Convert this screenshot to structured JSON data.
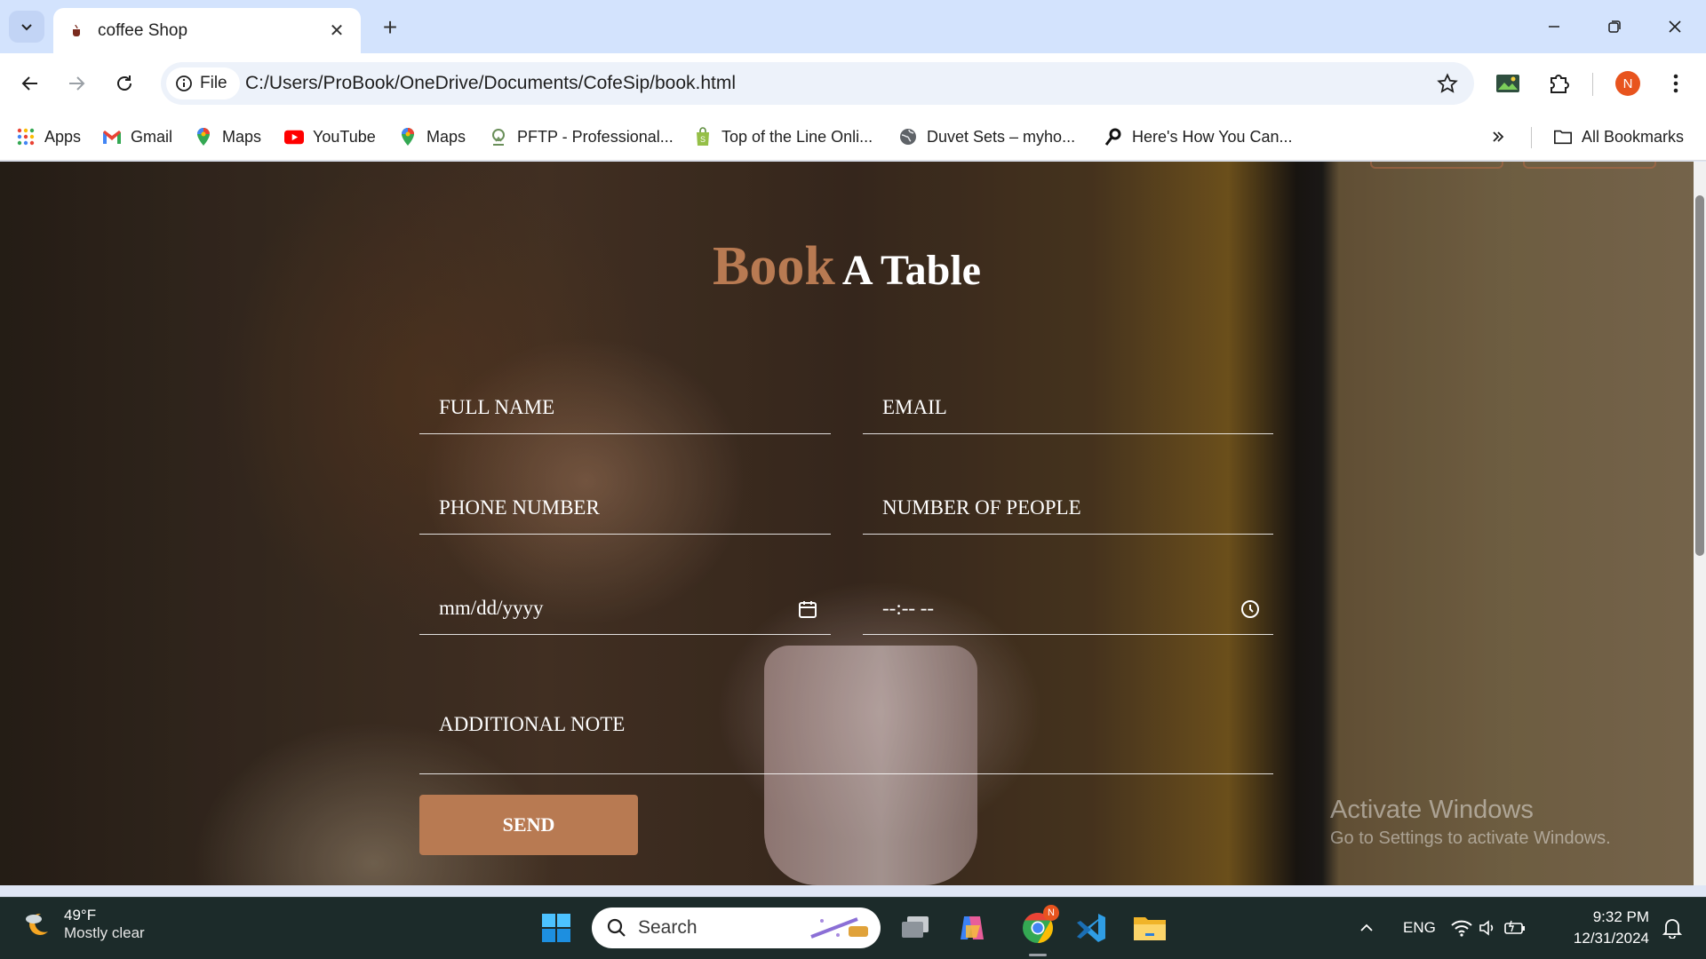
{
  "browser": {
    "tab_title": "coffee Shop",
    "site_chip": "File",
    "url": "C:/Users/ProBook/OneDrive/Documents/CofeSip/book.html",
    "profile_initial": "N",
    "bookmarks": [
      {
        "label": "Apps",
        "icon": "apps-grid-icon"
      },
      {
        "label": "Gmail",
        "icon": "gmail-icon"
      },
      {
        "label": "Maps",
        "icon": "maps-pin-icon"
      },
      {
        "label": "YouTube",
        "icon": "youtube-icon"
      },
      {
        "label": "Maps",
        "icon": "maps-pin-icon"
      },
      {
        "label": "PFTP - Professional...",
        "icon": "pftp-icon"
      },
      {
        "label": "Top of the Line Onli...",
        "icon": "shopify-bag-icon"
      },
      {
        "label": "Duvet Sets – myho...",
        "icon": "globe-icon"
      },
      {
        "label": "Here's How You Can...",
        "icon": "link-icon"
      }
    ],
    "all_bookmarks": "All Bookmarks"
  },
  "page": {
    "heading_accent": "Book",
    "heading_rest": "A Table",
    "fields": {
      "full_name": "FULL NAME",
      "email": "EMAIL",
      "phone": "PHONE NUMBER",
      "people": "NUMBER OF PEOPLE",
      "date": "mm/dd/yyyy",
      "time": "--:-- --",
      "note": "ADDITIONAL NOTE"
    },
    "send_label": "SEND",
    "accent_color": "#b87a52"
  },
  "watermark": {
    "line1": "Activate Windows",
    "line2": "Go to Settings to activate Windows."
  },
  "taskbar": {
    "temp": "49°F",
    "condition": "Mostly clear",
    "search_placeholder": "Search",
    "lang": "ENG",
    "time": "9:32 PM",
    "date": "12/31/2024",
    "chrome_badge": "N"
  }
}
